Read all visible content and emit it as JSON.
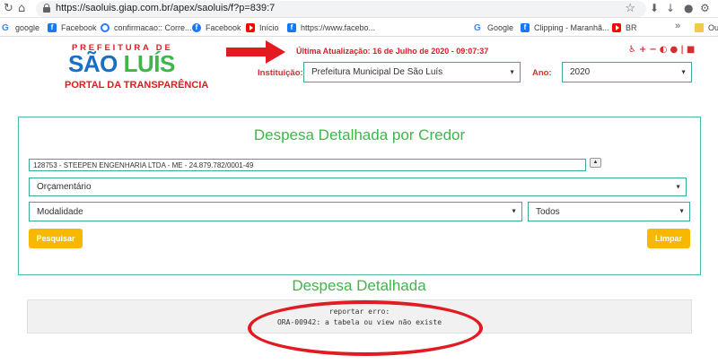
{
  "browser": {
    "url": "https://saoluis.giap.com.br/apex/saoluis/f?p=839:7",
    "bookmarks": [
      {
        "label": "google",
        "icon": "google-icon"
      },
      {
        "label": "Facebook",
        "icon": "facebook-icon"
      },
      {
        "label": "confirmacao:: Corre...",
        "icon": "confirmacao-icon"
      },
      {
        "label": "Facebook",
        "icon": "facebook-icon"
      },
      {
        "label": "Início",
        "icon": "youtube-icon"
      },
      {
        "label": "https://www.facebo...",
        "icon": "facebook-icon"
      },
      {
        "label": "Google",
        "icon": "google-icon"
      },
      {
        "label": "Clipping - Maranhã...",
        "icon": "facebook-icon"
      },
      {
        "label": "BR",
        "icon": "youtube-icon"
      },
      {
        "label": "»",
        "icon": "chevron-double-icon"
      },
      {
        "label": "Ou",
        "icon": "folder-icon"
      }
    ]
  },
  "header": {
    "logo_top": "PREFEITURA DE",
    "logo_main_1": "SÃO",
    "logo_main_2": "LUÍS",
    "logo_bottom": "PORTAL DA TRANSPARÊNCIA",
    "update": "Última Atualização: 16 de Julho de 2020 - 09:07:37",
    "institution_label": "Instituição:",
    "institution_value": "Prefeitura Municipal De São Luís",
    "year_label": "Ano:",
    "year_value": "2020",
    "accessibility": [
      "♿",
      "+",
      "−",
      "◐",
      "●",
      "|",
      "■"
    ]
  },
  "panel": {
    "title": "Despesa Detalhada por Credor",
    "creditor_value": "128753 - STEEPEN ENGENHARIA LTDA - ME - 24.879.782/0001-49",
    "budget_value": "Orçamentário",
    "modality_value": "Modalidade",
    "all_value": "Todos",
    "search_button": "Pesquisar",
    "clear_button": "Limpar"
  },
  "result": {
    "title": "Despesa Detalhada",
    "error_line1": "reportar erro:",
    "error_line2": "ORA-00942: a tabela ou view não existe"
  },
  "colors": {
    "accent_green": "#3fb54a",
    "border_teal": "#4db6ac",
    "alert_red": "#e21a22",
    "button_yellow": "#f9b800"
  }
}
